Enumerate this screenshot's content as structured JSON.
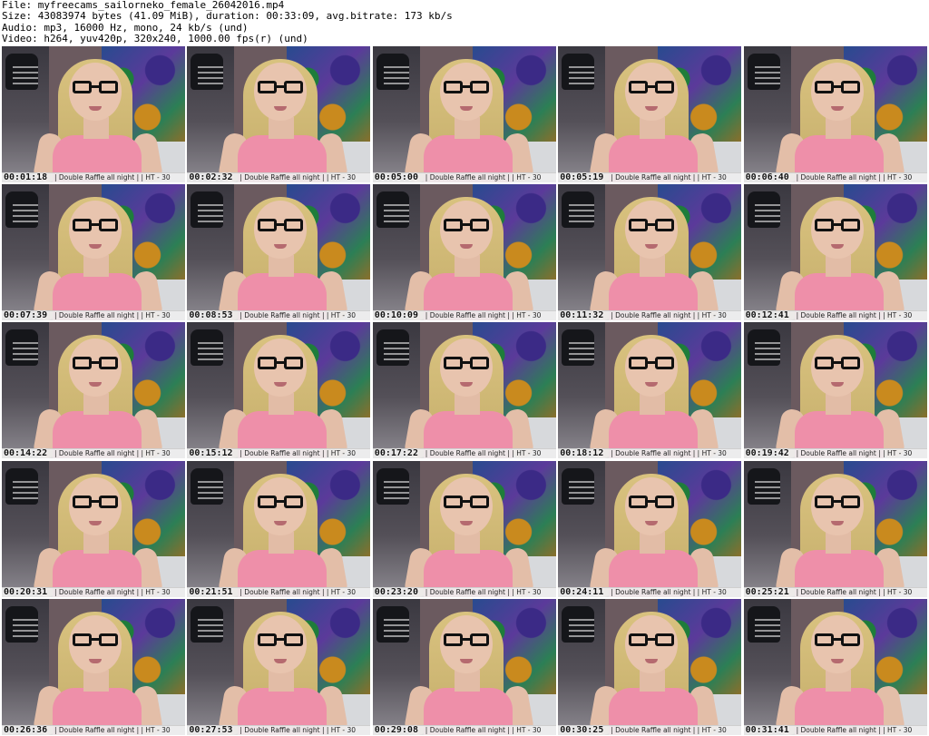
{
  "header": {
    "file": "File: myfreecams_sailorneko_female_26042016.mp4",
    "size": "Size: 43083974 bytes (41.09 MiB), duration: 00:33:09, avg.bitrate: 173 kb/s",
    "audio": "Audio: mp3, 16000 Hz, mono, 24 kb/s (und)",
    "video": "Video: h264, yuv420p, 320x240, 1000.00 fps(r) (und)"
  },
  "caption": "| Double Raffle all night |  | HT - 30",
  "timestamps": [
    "00:01:18",
    "00:02:32",
    "00:05:00",
    "00:05:19",
    "00:06:40",
    "00:07:39",
    "00:08:53",
    "00:10:09",
    "00:11:32",
    "00:12:41",
    "00:14:22",
    "00:15:12",
    "00:17:22",
    "00:18:12",
    "00:19:42",
    "00:20:31",
    "00:21:51",
    "00:23:20",
    "00:24:11",
    "00:25:21",
    "00:26:36",
    "00:27:53",
    "00:29:08",
    "00:30:25",
    "00:31:41"
  ]
}
